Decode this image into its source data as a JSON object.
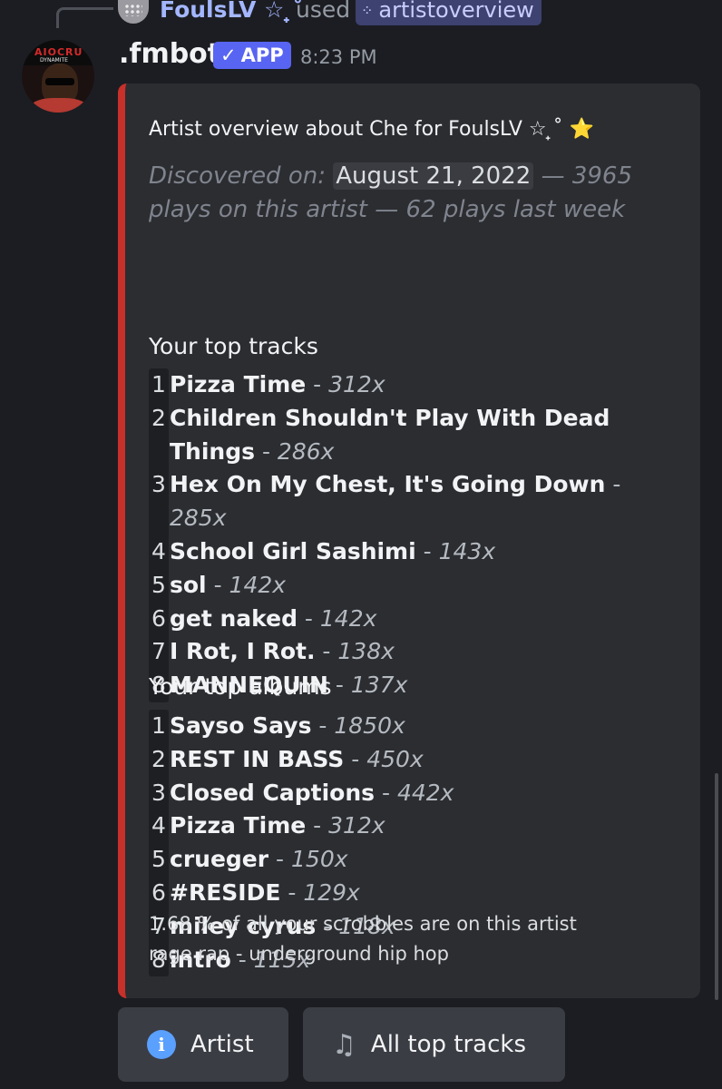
{
  "reply": {
    "user": "FoulsLV ☆ ̟˚",
    "used_label": "used",
    "command": "artistoverview",
    "command_icon": "slash-command-icon"
  },
  "message": {
    "bot_name": ".fmbot",
    "app_tag": "APP",
    "app_check": "✓",
    "timestamp": "8:23 PM",
    "accent_color": "#c8302a"
  },
  "embed": {
    "title": "Artist overview about Che for FoulsLV ☆ ̟˚ ⭐",
    "discovered_label": "Discovered on:",
    "discovered_date": "August 21, 2022",
    "stats": "— 3965 plays on this artist — 62 plays last week",
    "tracks_title": "Your top tracks",
    "tracks": [
      {
        "n": "1",
        "name": "Pizza Time",
        "count": "312x"
      },
      {
        "n": "2",
        "name": "Children Shouldn't Play With Dead Things",
        "count": "286x"
      },
      {
        "n": "3",
        "name": "Hex On My Chest, It's Going Down",
        "count": "285x"
      },
      {
        "n": "4",
        "name": "School Girl Sashimi",
        "count": "143x"
      },
      {
        "n": "5",
        "name": "sol",
        "count": "142x"
      },
      {
        "n": "6",
        "name": "get naked",
        "count": "142x"
      },
      {
        "n": "7",
        "name": "I Rot, I Rot.",
        "count": "138x"
      },
      {
        "n": "8",
        "name": "MANNEQUIN",
        "count": "137x"
      }
    ],
    "albums_title": "Your top albums",
    "albums": [
      {
        "n": "1",
        "name": "Sayso Says",
        "count": "1850x"
      },
      {
        "n": "2",
        "name": "REST IN BASS",
        "count": "450x"
      },
      {
        "n": "3",
        "name": "Closed Captions",
        "count": "442x"
      },
      {
        "n": "4",
        "name": "Pizza Time",
        "count": "312x"
      },
      {
        "n": "5",
        "name": "crueger",
        "count": "150x"
      },
      {
        "n": "6",
        "name": "#RESIDE",
        "count": "129x"
      },
      {
        "n": "7",
        "name": "miley cyrus",
        "count": "118x"
      },
      {
        "n": "8",
        "name": "intro",
        "count": "115x"
      }
    ],
    "footer_line1": "1.68 % of all your scrobbles are on this artist",
    "footer_line2": "rage rap - underground hip hop"
  },
  "buttons": {
    "artist_label": "Artist",
    "artist_icon": "info-icon",
    "tracks_label": "All top tracks",
    "tracks_icon": "music-notes-icon"
  }
}
